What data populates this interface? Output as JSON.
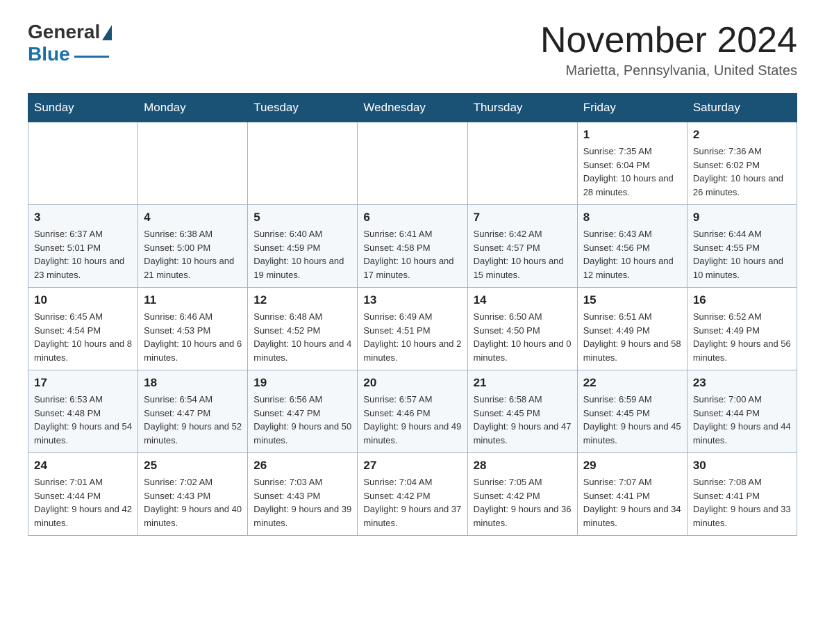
{
  "header": {
    "logo_general": "General",
    "logo_blue": "Blue",
    "month_title": "November 2024",
    "location": "Marietta, Pennsylvania, United States"
  },
  "weekdays": [
    "Sunday",
    "Monday",
    "Tuesday",
    "Wednesday",
    "Thursday",
    "Friday",
    "Saturday"
  ],
  "weeks": [
    [
      {
        "day": "",
        "info": ""
      },
      {
        "day": "",
        "info": ""
      },
      {
        "day": "",
        "info": ""
      },
      {
        "day": "",
        "info": ""
      },
      {
        "day": "",
        "info": ""
      },
      {
        "day": "1",
        "info": "Sunrise: 7:35 AM\nSunset: 6:04 PM\nDaylight: 10 hours and 28 minutes."
      },
      {
        "day": "2",
        "info": "Sunrise: 7:36 AM\nSunset: 6:02 PM\nDaylight: 10 hours and 26 minutes."
      }
    ],
    [
      {
        "day": "3",
        "info": "Sunrise: 6:37 AM\nSunset: 5:01 PM\nDaylight: 10 hours and 23 minutes."
      },
      {
        "day": "4",
        "info": "Sunrise: 6:38 AM\nSunset: 5:00 PM\nDaylight: 10 hours and 21 minutes."
      },
      {
        "day": "5",
        "info": "Sunrise: 6:40 AM\nSunset: 4:59 PM\nDaylight: 10 hours and 19 minutes."
      },
      {
        "day": "6",
        "info": "Sunrise: 6:41 AM\nSunset: 4:58 PM\nDaylight: 10 hours and 17 minutes."
      },
      {
        "day": "7",
        "info": "Sunrise: 6:42 AM\nSunset: 4:57 PM\nDaylight: 10 hours and 15 minutes."
      },
      {
        "day": "8",
        "info": "Sunrise: 6:43 AM\nSunset: 4:56 PM\nDaylight: 10 hours and 12 minutes."
      },
      {
        "day": "9",
        "info": "Sunrise: 6:44 AM\nSunset: 4:55 PM\nDaylight: 10 hours and 10 minutes."
      }
    ],
    [
      {
        "day": "10",
        "info": "Sunrise: 6:45 AM\nSunset: 4:54 PM\nDaylight: 10 hours and 8 minutes."
      },
      {
        "day": "11",
        "info": "Sunrise: 6:46 AM\nSunset: 4:53 PM\nDaylight: 10 hours and 6 minutes."
      },
      {
        "day": "12",
        "info": "Sunrise: 6:48 AM\nSunset: 4:52 PM\nDaylight: 10 hours and 4 minutes."
      },
      {
        "day": "13",
        "info": "Sunrise: 6:49 AM\nSunset: 4:51 PM\nDaylight: 10 hours and 2 minutes."
      },
      {
        "day": "14",
        "info": "Sunrise: 6:50 AM\nSunset: 4:50 PM\nDaylight: 10 hours and 0 minutes."
      },
      {
        "day": "15",
        "info": "Sunrise: 6:51 AM\nSunset: 4:49 PM\nDaylight: 9 hours and 58 minutes."
      },
      {
        "day": "16",
        "info": "Sunrise: 6:52 AM\nSunset: 4:49 PM\nDaylight: 9 hours and 56 minutes."
      }
    ],
    [
      {
        "day": "17",
        "info": "Sunrise: 6:53 AM\nSunset: 4:48 PM\nDaylight: 9 hours and 54 minutes."
      },
      {
        "day": "18",
        "info": "Sunrise: 6:54 AM\nSunset: 4:47 PM\nDaylight: 9 hours and 52 minutes."
      },
      {
        "day": "19",
        "info": "Sunrise: 6:56 AM\nSunset: 4:47 PM\nDaylight: 9 hours and 50 minutes."
      },
      {
        "day": "20",
        "info": "Sunrise: 6:57 AM\nSunset: 4:46 PM\nDaylight: 9 hours and 49 minutes."
      },
      {
        "day": "21",
        "info": "Sunrise: 6:58 AM\nSunset: 4:45 PM\nDaylight: 9 hours and 47 minutes."
      },
      {
        "day": "22",
        "info": "Sunrise: 6:59 AM\nSunset: 4:45 PM\nDaylight: 9 hours and 45 minutes."
      },
      {
        "day": "23",
        "info": "Sunrise: 7:00 AM\nSunset: 4:44 PM\nDaylight: 9 hours and 44 minutes."
      }
    ],
    [
      {
        "day": "24",
        "info": "Sunrise: 7:01 AM\nSunset: 4:44 PM\nDaylight: 9 hours and 42 minutes."
      },
      {
        "day": "25",
        "info": "Sunrise: 7:02 AM\nSunset: 4:43 PM\nDaylight: 9 hours and 40 minutes."
      },
      {
        "day": "26",
        "info": "Sunrise: 7:03 AM\nSunset: 4:43 PM\nDaylight: 9 hours and 39 minutes."
      },
      {
        "day": "27",
        "info": "Sunrise: 7:04 AM\nSunset: 4:42 PM\nDaylight: 9 hours and 37 minutes."
      },
      {
        "day": "28",
        "info": "Sunrise: 7:05 AM\nSunset: 4:42 PM\nDaylight: 9 hours and 36 minutes."
      },
      {
        "day": "29",
        "info": "Sunrise: 7:07 AM\nSunset: 4:41 PM\nDaylight: 9 hours and 34 minutes."
      },
      {
        "day": "30",
        "info": "Sunrise: 7:08 AM\nSunset: 4:41 PM\nDaylight: 9 hours and 33 minutes."
      }
    ]
  ]
}
